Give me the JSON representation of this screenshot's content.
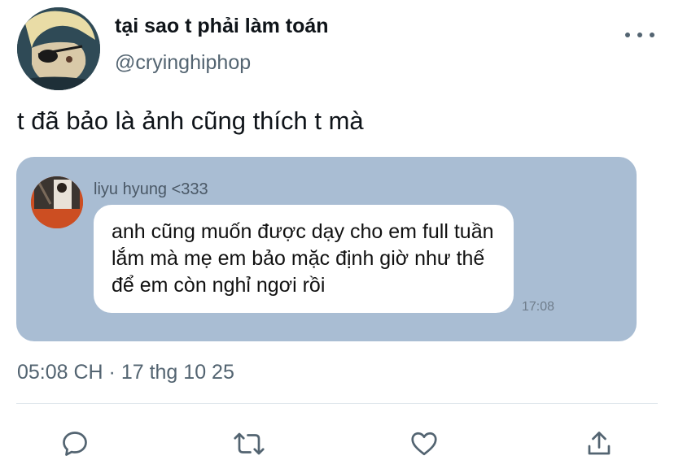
{
  "tweet": {
    "author": {
      "display_name": "tại sao t phải làm toán",
      "handle": "@cryinghiphop",
      "avatar": "avatar"
    },
    "text": "t đã bảo là ảnh cũng thích t mà",
    "timestamp": "05:08 CH · 17 thg 10 25"
  },
  "media": {
    "chat": {
      "sender_name": "liyu hyung <333",
      "message": "anh cũng muốn được dạy cho em full tuần lắm mà mẹ em bảo mặc định giờ như thế để em còn nghỉ ngơi rồi",
      "time": "17:08"
    }
  },
  "actions": {
    "icons": [
      "reply-icon",
      "retweet-icon",
      "like-icon",
      "share-icon"
    ]
  },
  "colors": {
    "secondary_text": "#536471",
    "chat_background": "#a9bdd3",
    "bubble": "#ffffff"
  }
}
